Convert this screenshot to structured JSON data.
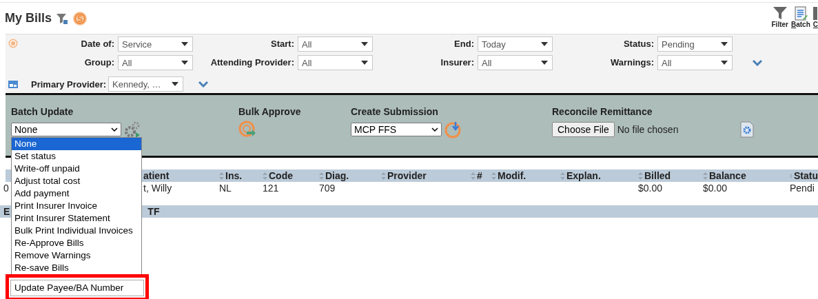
{
  "header": {
    "title": "My Bills",
    "toolbar": [
      {
        "label": "Filter",
        "kind": "filter"
      },
      {
        "label": "Batch",
        "kind": "batch"
      },
      {
        "label": "C",
        "kind": "other"
      }
    ]
  },
  "filters": {
    "fields": [
      {
        "label": "Date of:",
        "value": "Service"
      },
      {
        "label": "Start:",
        "value": "All"
      },
      {
        "label": "End:",
        "value": "Today"
      },
      {
        "label": "Status:",
        "value": "Pending"
      },
      {
        "label": "Group:",
        "value": "All"
      },
      {
        "label": "Attending Provider:",
        "value": "All"
      },
      {
        "label": "Insurer:",
        "value": "All"
      },
      {
        "label": "Warnings:",
        "value": "All"
      }
    ],
    "primary_provider": {
      "label": "Primary Provider:",
      "value": "Kennedy, …"
    }
  },
  "actions": {
    "batch_update": {
      "title": "Batch Update",
      "value": "None",
      "options": [
        {
          "label": "None",
          "selected": true
        },
        {
          "label": "Set status",
          "selected": false
        },
        {
          "label": "Write-off unpaid",
          "selected": false
        },
        {
          "label": "Adjust total cost",
          "selected": false
        },
        {
          "label": "Add payment",
          "selected": false
        },
        {
          "label": "Print Insurer Invoice",
          "selected": false
        },
        {
          "label": "Print Insurer Statement",
          "selected": false
        },
        {
          "label": "Bulk Print Individual Invoices",
          "selected": false
        },
        {
          "label": "Re-Approve Bills",
          "selected": false
        },
        {
          "label": "Remove Warnings",
          "selected": false
        },
        {
          "label": "Re-save Bills",
          "selected": false
        }
      ],
      "highlighted_option": "Update Payee/BA Number"
    },
    "bulk_approve": {
      "title": "Bulk Approve"
    },
    "create_submission": {
      "title": "Create Submission",
      "value": "MCP FFS"
    },
    "reconcile_remittance": {
      "title": "Reconcile Remittance",
      "button": "Choose File",
      "file_status": "No file chosen"
    }
  },
  "table": {
    "columns": [
      null,
      {
        "label": "atient",
        "sort_icon": false
      },
      {
        "label": "Ins.",
        "sort_icon": true
      },
      {
        "label": "Code",
        "sort_icon": true
      },
      {
        "label": "Diag.",
        "sort_icon": true
      },
      {
        "label": "Provider",
        "sort_icon": true
      },
      {
        "label": "#",
        "sort_icon": true
      },
      {
        "label": "Modif.",
        "sort_icon": true
      },
      {
        "label": "Explan.",
        "sort_icon": true
      },
      {
        "label": "Billed",
        "sort_icon": true
      },
      {
        "label": "Balance",
        "sort_icon": true
      },
      {
        "label": "Statu",
        "sort_icon": true
      }
    ],
    "rows": [
      [
        "0",
        "t, Willy",
        "NL",
        "121",
        "709",
        "",
        "",
        "",
        "",
        "$0.00",
        "$0.00",
        "Pendi"
      ]
    ],
    "group_row": [
      "E",
      "TF"
    ]
  }
}
